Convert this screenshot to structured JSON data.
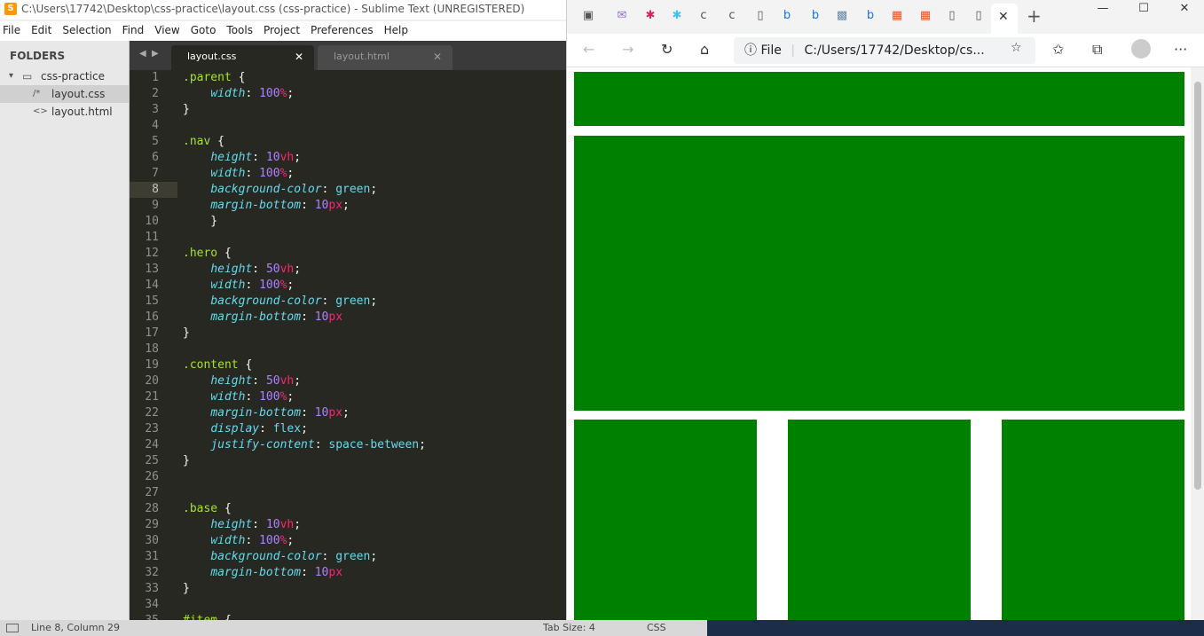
{
  "sublime": {
    "title": "C:\\Users\\17742\\Desktop\\css-practice\\layout.css (css-practice) - Sublime Text (UNREGISTERED)",
    "menu": [
      "File",
      "Edit",
      "Selection",
      "Find",
      "View",
      "Goto",
      "Tools",
      "Project",
      "Preferences",
      "Help"
    ],
    "sidebar": {
      "header": "FOLDERS",
      "folder": "css-practice",
      "files": [
        "layout.css",
        "layout.html"
      ]
    },
    "tabs": [
      {
        "label": "layout.css",
        "active": true
      },
      {
        "label": "layout.html",
        "active": false
      }
    ],
    "current_line": 8,
    "lines": [
      ".parent {",
      "    width: 100%;",
      "}",
      "",
      ".nav {",
      "    height: 10vh;",
      "    width: 100%;",
      "    background-color: green;",
      "    margin-bottom: 10px;",
      "    }",
      "",
      ".hero {",
      "    height: 50vh;",
      "    width: 100%;",
      "    background-color: green;",
      "    margin-bottom: 10px",
      "}",
      "",
      ".content {",
      "    height: 50vh;",
      "    width: 100%;",
      "    margin-bottom: 10px;",
      "    display: flex;",
      "    justify-content: space-between;",
      "}",
      "",
      "",
      ".base {",
      "    height: 10vh;",
      "    width: 100%;",
      "    background-color: green;",
      "    margin-bottom: 10px",
      "}",
      "",
      "#item {"
    ],
    "status": {
      "position": "Line 8, Column 29",
      "tab_size": "Tab Size: 4",
      "syntax": "CSS"
    }
  },
  "browser": {
    "address_label": "File",
    "address": "C:/Users/17742/Desktop/cs...",
    "icons": [
      "back-icon",
      "forward-icon",
      "refresh-icon",
      "home-icon",
      "info-icon",
      "favorite-add-icon",
      "favorites-icon",
      "collections-icon",
      "profile-icon",
      "more-icon"
    ]
  },
  "colors": {
    "block": "#008000",
    "editor_bg": "#272822"
  }
}
